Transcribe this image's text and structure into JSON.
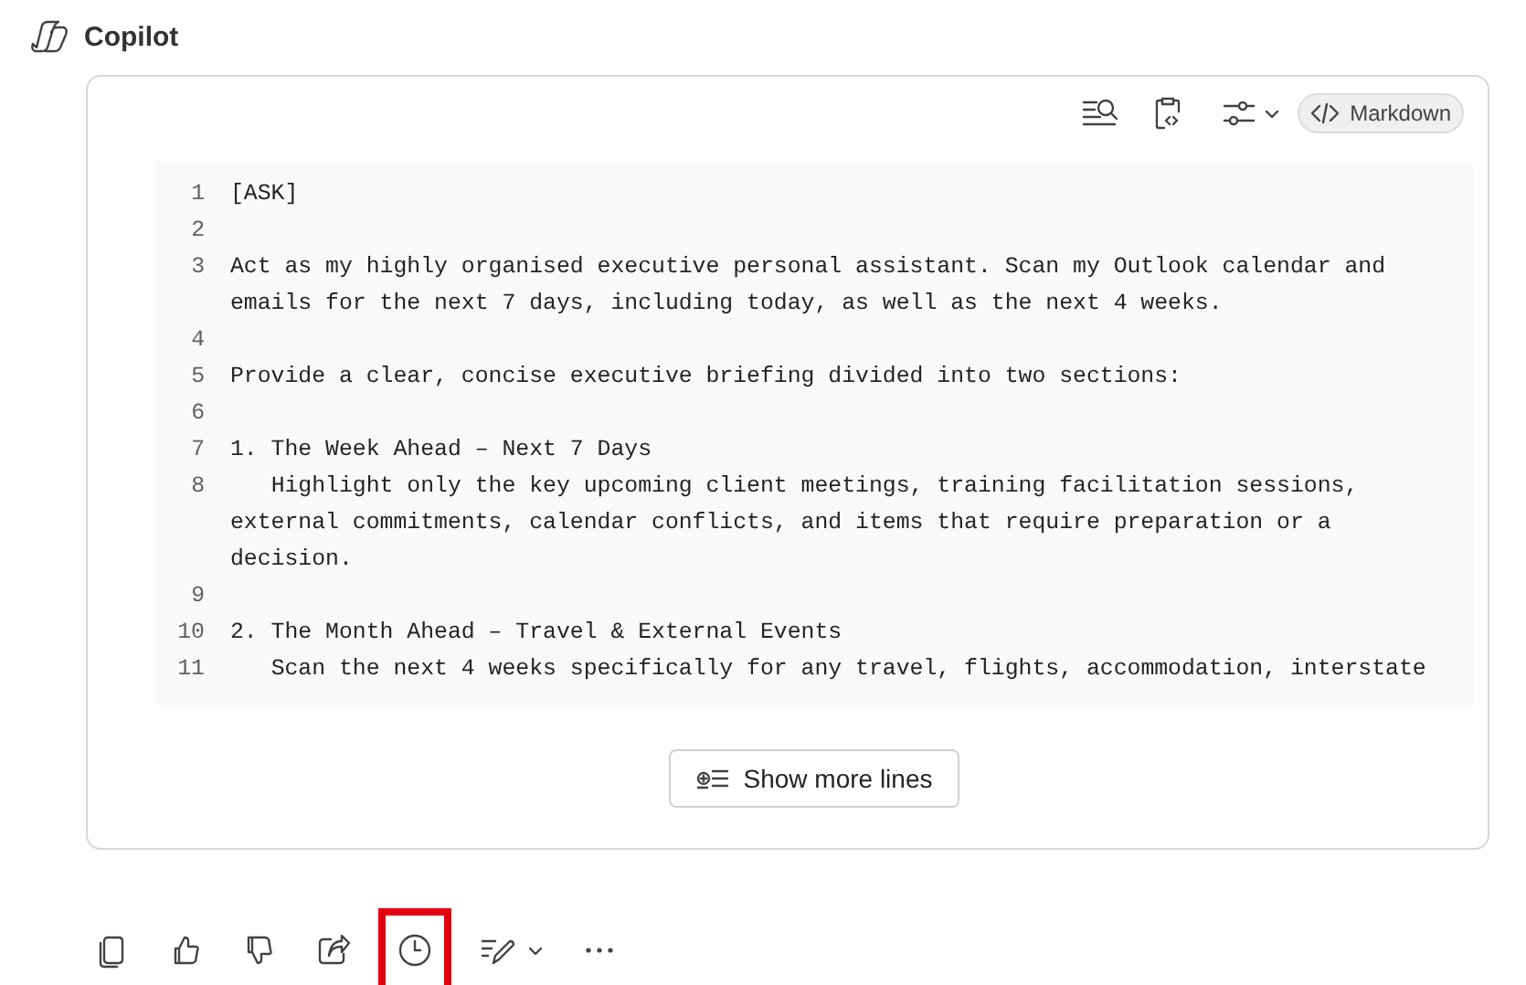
{
  "header": {
    "title": "Copilot"
  },
  "code_block": {
    "format_label": "Markdown",
    "lines": [
      {
        "number": "1",
        "text": "[ASK]"
      },
      {
        "number": "2"
      },
      {
        "number": "3",
        "text": "Act as my highly organised executive personal assistant. Scan my Outlook calendar and emails for the next 7 days, including today, as well as the next 4 weeks."
      },
      {
        "number": "4"
      },
      {
        "number": "5",
        "text": "Provide a clear, concise executive briefing divided into two sections:"
      },
      {
        "number": "6"
      },
      {
        "number": "7",
        "text": "1. The Week Ahead – Next 7 Days"
      },
      {
        "number": "8",
        "text": "   Highlight only the key upcoming client meetings, training facilitation sessions, external commitments, calendar conflicts, and items that require preparation or a decision."
      },
      {
        "number": "9"
      },
      {
        "number": "10",
        "text": "2. The Month Ahead – Travel & External Events"
      },
      {
        "number": "11",
        "text": "   Scan the next 4 weeks specifically for any travel, flights, accommodation, interstate"
      }
    ],
    "show_more": "Show more lines"
  },
  "actions": [
    {
      "kind": "copy",
      "highlighted": false
    },
    {
      "kind": "like",
      "highlighted": false
    },
    {
      "kind": "dislike",
      "highlighted": false
    },
    {
      "kind": "share",
      "highlighted": false
    },
    {
      "kind": "clock",
      "highlighted": true
    },
    {
      "kind": "edit",
      "highlighted": false
    },
    {
      "kind": "more",
      "highlighted": false
    }
  ]
}
